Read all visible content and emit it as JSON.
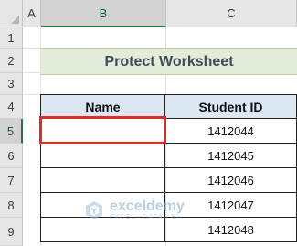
{
  "column_headers": [
    "A",
    "B",
    "C"
  ],
  "row_headers": [
    "1",
    "2",
    "3",
    "4",
    "5",
    "6",
    "7",
    "8",
    "9"
  ],
  "active": {
    "column": "B",
    "row": "5"
  },
  "title": "Protect Worksheet",
  "table": {
    "headers": [
      "Name",
      "Student ID"
    ],
    "rows": [
      [
        "",
        "1412044"
      ],
      [
        "",
        "1412045"
      ],
      [
        "",
        "1412046"
      ],
      [
        "",
        "1412047"
      ],
      [
        "",
        "1412048"
      ]
    ]
  },
  "watermark": {
    "name": "exceldemy",
    "tagline": "EXCEL · DATA · BI"
  },
  "colors": {
    "title_band": "#e2ecd9",
    "header_fill": "#dbe8f4",
    "selection_box": "#e02b2b",
    "excel_green": "#217346"
  }
}
